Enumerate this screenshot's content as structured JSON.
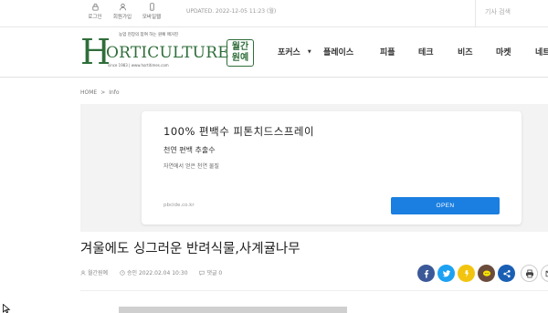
{
  "topbar": {
    "login": "로그인",
    "join": "회원가입",
    "mobile": "모바일웹",
    "updated": "UPDATED. 2022-12-05 11:23 (월)",
    "search_placeholder": "기사 검색"
  },
  "logo": {
    "tagline": "농업 현장의 참여 하는 원예 매거진",
    "letter": "H",
    "word": "ORTICULTURE",
    "since": "since 1983 | www.hortitimes.com",
    "badge_line1": "월간",
    "badge_line2": "원예"
  },
  "nav": {
    "items": [
      "포커스",
      "플레이스",
      "피플",
      "테크",
      "비즈",
      "마켓",
      "네트"
    ]
  },
  "breadcrumb": {
    "home": "HOME",
    "sep": ">",
    "section": "Info"
  },
  "ad": {
    "title": "100% 편백수 피톤치드스프레이",
    "subtitle": "천연 편백 추출수",
    "description": "자연에서 얻은 천연 물질",
    "url": "pbcide.co.kr",
    "button": "OPEN",
    "button_color": "#1a7fe0"
  },
  "article": {
    "headline": "겨울에도 싱그러운 반려식물,사계귤나무",
    "author": "월간원예",
    "date": "승인 2022.02.04 10:30",
    "comments": "댓글 0"
  },
  "share_colors": {
    "facebook": "#3b5998",
    "twitter": "#1da1f2",
    "kakaostory": "#f2c40f",
    "kakaotalk": "#6b4c3b",
    "share": "#1a5fb4"
  },
  "brand_color": "#2f6e3a"
}
